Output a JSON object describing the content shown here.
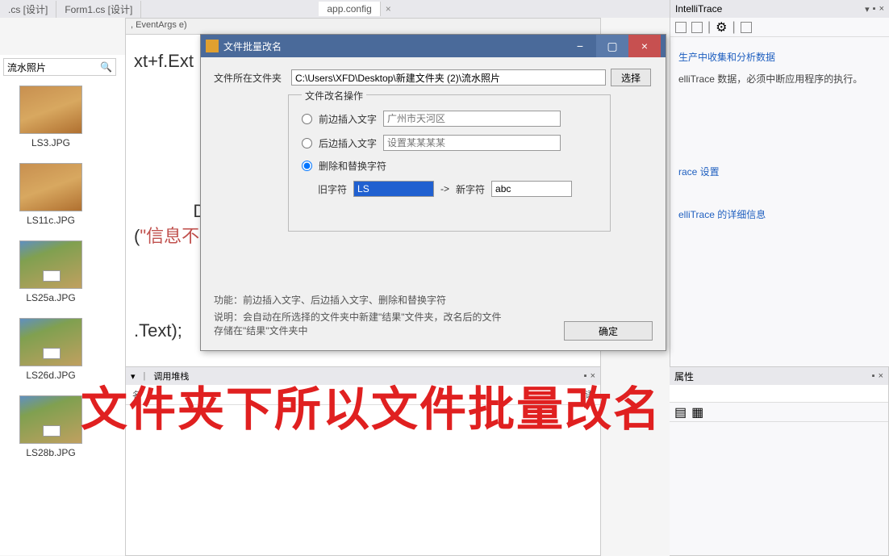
{
  "tabs": {
    "t1": ".cs [设计]",
    "t2": "Form1.cs [设计]",
    "t3": "app.config",
    "close": "×"
  },
  "code": {
    "header": ", EventArgs e)",
    "line1a": "xt+f.Ext",
    "line2": "            D",
    "line3a": "(",
    "line3b": "\"信息不",
    "line4a": ".Text);"
  },
  "sidebar": {
    "search": "流水照片",
    "thumbs": [
      {
        "label": "LS3.JPG"
      },
      {
        "label": "LS11c.JPG"
      },
      {
        "label": "LS25a.JPG"
      },
      {
        "label": "LS26d.JPG"
      },
      {
        "label": "LS28b.JPG"
      }
    ]
  },
  "rightPanel": {
    "title": "IntelliTrace",
    "link1": "生产中收集和分析数据",
    "text1": "elliTrace 数据，必须中断应用程序的执行。",
    "link2": "race 设置",
    "link3": "elliTrace 的详细信息"
  },
  "dialog": {
    "title": "文件批量改名",
    "folderLabel": "文件所在文件夹",
    "folderPath": "C:\\Users\\XFD\\Desktop\\新建文件夹 (2)\\流水照片",
    "browseBtn": "选择",
    "groupTitle": "文件改名操作",
    "opt1": "前边插入文字",
    "opt1ph": "广州市天河区",
    "opt2": "后边插入文字",
    "opt2ph": "设置某某某某",
    "opt3": "删除和替换字符",
    "oldCharLabel": "旧字符",
    "oldCharVal": "LS",
    "arrow": "->",
    "newCharLabel": "新字符",
    "newCharVal": "abc",
    "funcLabel": "功能：前边插入文字、后边插入文字、删除和替换字符",
    "descLabel": "说明：会自动在所选择的文件夹中新建\"结果\"文件夹，改名后的文件存储在\"结果\"文件夹中",
    "confirmBtn": "确定"
  },
  "bottomPanel": {
    "title": "调用堆栈",
    "col1": "名",
    "col2": "语"
  },
  "propsPanel": {
    "title": "属性"
  },
  "overlay": "文件夹下所以文件批量改名",
  "winCtrls": {
    "min": "−",
    "pin": "▪",
    "close": "×",
    "down": "▾"
  }
}
